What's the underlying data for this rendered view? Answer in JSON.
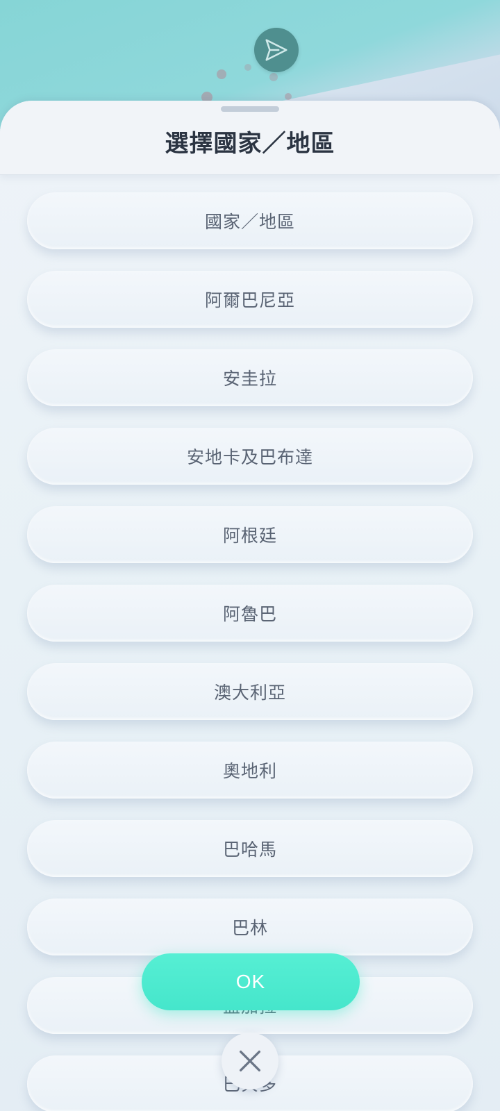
{
  "header": {
    "title": "選擇國家／地區"
  },
  "icons": {
    "top_button": "send-icon",
    "close": "close-icon"
  },
  "list": {
    "items": [
      "國家／地區",
      "阿爾巴尼亞",
      "安圭拉",
      "安地卡及巴布達",
      "阿根廷",
      "阿魯巴",
      "澳大利亞",
      "奧地利",
      "巴哈馬",
      "巴林",
      "孟加拉",
      "巴貝多"
    ]
  },
  "actions": {
    "ok_label": "OK"
  },
  "colors": {
    "accent": "#4FEBD0",
    "send_button": "#4F8F8F",
    "title_text": "#2B3442",
    "item_text": "#596373"
  }
}
